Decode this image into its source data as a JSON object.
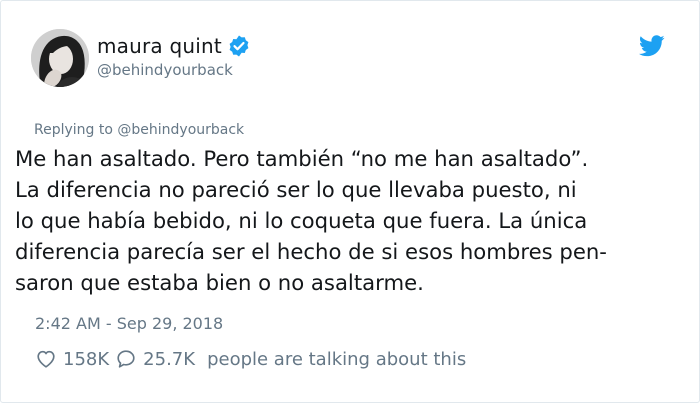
{
  "author": {
    "display_name": "maura quint",
    "handle": "@behindyourback",
    "verified": true
  },
  "reply": {
    "prefix": "Replying to",
    "mention": "@behindyourback"
  },
  "tweet": {
    "lines": [
      "Me han asaltado. Pero también “no me han asaltado”.",
      "La diferencia no pareció ser lo que llevaba puesto, ni",
      "lo que había bebido, ni lo coqueta que fuera. La única",
      "diferencia parecía ser el hecho de si esos hombres pen-",
      "saron que estaba bien o no asaltarme."
    ],
    "timestamp": "2:42 AM - Sep 29, 2018"
  },
  "engagement": {
    "likes": "158K",
    "replies": "25.7K",
    "people_text": "people are talking about this"
  },
  "icons": {
    "verified": "verified-badge-icon",
    "brand": "twitter-bird-icon",
    "like": "heart-icon",
    "reply": "speech-bubble-icon"
  },
  "colors": {
    "brand_blue": "#1da1f2",
    "text_primary": "#14171a",
    "text_secondary": "#657786",
    "border": "#e1e8ed"
  }
}
